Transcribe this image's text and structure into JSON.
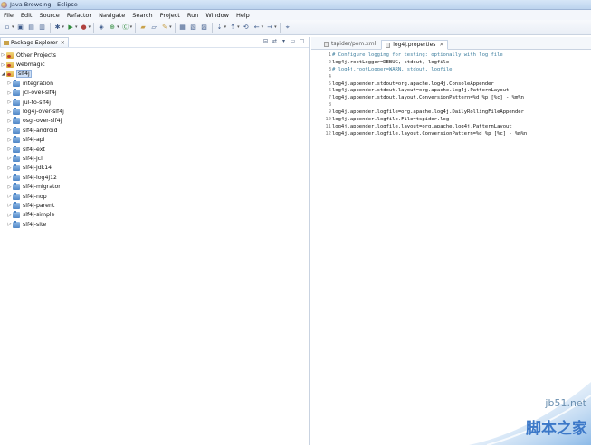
{
  "window": {
    "title": "Java Browsing - Eclipse"
  },
  "menubar": {
    "items": [
      "File",
      "Edit",
      "Source",
      "Refactor",
      "Navigate",
      "Search",
      "Project",
      "Run",
      "Window",
      "Help"
    ]
  },
  "toolbar": {
    "icons": [
      "new-icon",
      "save-icon",
      "print-icon",
      "debug-icon",
      "run-icon",
      "external-tools-icon",
      "new-java-project-icon",
      "new-package-icon",
      "new-class-icon",
      "open-type-icon",
      "search-icon",
      "next-annotation-icon",
      "previous-annotation-icon",
      "back-icon",
      "forward-icon",
      "pin-editor-icon"
    ]
  },
  "package_explorer": {
    "tab_label": "Package Explorer",
    "items": [
      {
        "label": "Other Projects",
        "type": "working-set",
        "expanded": false
      },
      {
        "label": "webmagic",
        "type": "working-set",
        "expanded": false
      },
      {
        "label": "slf4j",
        "type": "working-set",
        "expanded": true,
        "selected": true
      },
      {
        "label": "integration",
        "type": "project"
      },
      {
        "label": "jcl-over-slf4j",
        "type": "project"
      },
      {
        "label": "jul-to-slf4j",
        "type": "project"
      },
      {
        "label": "log4j-over-slf4j",
        "type": "project"
      },
      {
        "label": "osgi-over-slf4j",
        "type": "project"
      },
      {
        "label": "slf4j-android",
        "type": "project"
      },
      {
        "label": "slf4j-api",
        "type": "project"
      },
      {
        "label": "slf4j-ext",
        "type": "project"
      },
      {
        "label": "slf4j-jcl",
        "type": "project"
      },
      {
        "label": "slf4j-jdk14",
        "type": "project"
      },
      {
        "label": "slf4j-log4j12",
        "type": "project"
      },
      {
        "label": "slf4j-migrator",
        "type": "project"
      },
      {
        "label": "slf4j-nop",
        "type": "project"
      },
      {
        "label": "slf4j-parent",
        "type": "project"
      },
      {
        "label": "slf4j-simple",
        "type": "project"
      },
      {
        "label": "slf4j-site",
        "type": "project"
      }
    ]
  },
  "editor": {
    "tabs": [
      {
        "label": "tspider/pom.xml",
        "active": false
      },
      {
        "label": "log4j.properties",
        "active": true
      }
    ],
    "lines": [
      {
        "n": "1",
        "text": "# Configure logging for testing: optionally with log file"
      },
      {
        "n": "2",
        "text": "log4j.rootLogger=DEBUG, stdout, logfile"
      },
      {
        "n": "3",
        "text": "# log4j.rootLogger=WARN, stdout, logfile"
      },
      {
        "n": "4",
        "text": ""
      },
      {
        "n": "5",
        "text": "log4j.appender.stdout=org.apache.log4j.ConsoleAppender"
      },
      {
        "n": "6",
        "text": "log4j.appender.stdout.layout=org.apache.log4j.PatternLayout"
      },
      {
        "n": "7",
        "text": "log4j.appender.stdout.layout.ConversionPattern=%d %p [%c] - %m%n"
      },
      {
        "n": "8",
        "text": ""
      },
      {
        "n": "9",
        "text": "log4j.appender.logfile=org.apache.log4j.DailyRollingFileAppender"
      },
      {
        "n": "10",
        "text": "log4j.appender.logfile.File=tspider.log"
      },
      {
        "n": "11",
        "text": "log4j.appender.logfile.layout=org.apache.log4j.PatternLayout"
      },
      {
        "n": "12",
        "text": "log4j.appender.logfile.layout.ConversionPattern=%d %p [%c] - %m%n"
      }
    ]
  },
  "watermark": {
    "domain": "jb51.net",
    "brand": "脚本之家"
  }
}
